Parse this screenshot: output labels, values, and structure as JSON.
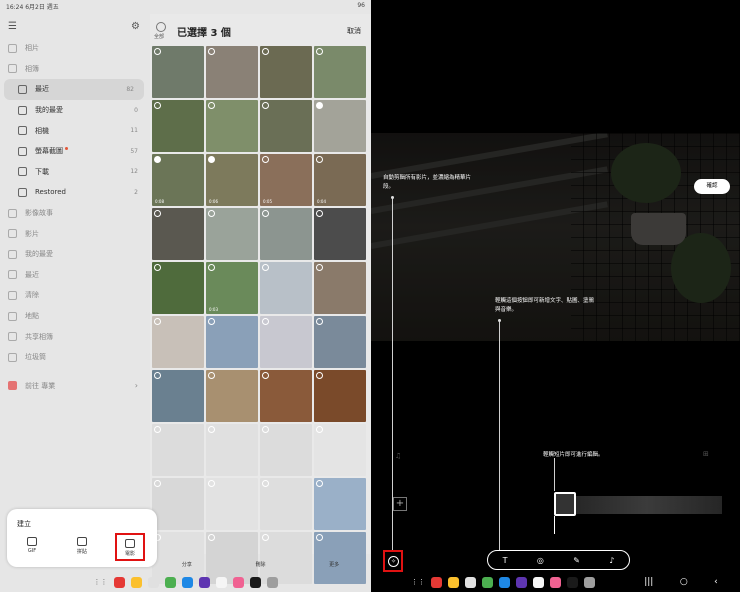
{
  "status": {
    "time": "16:24",
    "date": "6月2日 週五",
    "battery": "96"
  },
  "sidebar": {
    "items": [
      {
        "label": "相片",
        "count": "",
        "type": "top"
      },
      {
        "label": "相簿",
        "count": "",
        "type": "top"
      },
      {
        "label": "最近",
        "count": "82",
        "type": "sub",
        "selected": true
      },
      {
        "label": "我的最愛",
        "count": "0",
        "type": "sub"
      },
      {
        "label": "相機",
        "count": "11",
        "type": "sub"
      },
      {
        "label": "螢幕截圖",
        "count": "57",
        "type": "sub",
        "dot": true
      },
      {
        "label": "下載",
        "count": "12",
        "type": "sub"
      },
      {
        "label": "Restored",
        "count": "2",
        "type": "sub"
      },
      {
        "label": "影像故事",
        "count": "",
        "type": "top"
      },
      {
        "label": "影片",
        "count": "",
        "type": "top"
      },
      {
        "label": "我的最愛",
        "count": "",
        "type": "top"
      },
      {
        "label": "最近",
        "count": "",
        "type": "top"
      },
      {
        "label": "清除",
        "count": "",
        "type": "top"
      },
      {
        "label": "地點",
        "count": "",
        "type": "top"
      },
      {
        "label": "共享相簿",
        "count": "",
        "type": "top"
      },
      {
        "label": "垃圾筒",
        "count": "",
        "type": "top"
      },
      {
        "label": "前往 專業",
        "count": "",
        "type": "promo"
      }
    ]
  },
  "gallery": {
    "select_all": "全部",
    "title": "已選擇 3 個",
    "cancel": "取消",
    "thumbs": [
      {
        "color": "#6f7a6a",
        "check": false
      },
      {
        "color": "#8a8176",
        "check": false
      },
      {
        "color": "#6b6a52",
        "check": false
      },
      {
        "color": "#7a8a6a",
        "check": false
      },
      {
        "color": "#5e6e4a",
        "check": false
      },
      {
        "color": "#7f8f6a",
        "check": false
      },
      {
        "color": "#6a6f56",
        "check": false
      },
      {
        "color": "#a3a399",
        "check": true
      },
      {
        "color": "#6b7557",
        "check": true,
        "dur": "0:08"
      },
      {
        "color": "#7d7a5c",
        "check": true,
        "dur": "0:06"
      },
      {
        "color": "#8a6f5a",
        "check": false,
        "dur": "0:05"
      },
      {
        "color": "#7a6a54",
        "check": false,
        "dur": "0:04"
      },
      {
        "color": "#5a5850",
        "check": false
      },
      {
        "color": "#9aa39a",
        "check": false
      },
      {
        "color": "#8c9590",
        "check": false
      },
      {
        "color": "#4c4c4c",
        "check": false
      },
      {
        "color": "#4f6b3c",
        "check": false
      },
      {
        "color": "#6a8a5a",
        "check": false,
        "dur": "0:03"
      },
      {
        "color": "#b8c0c8",
        "check": false
      },
      {
        "color": "#8a7a6a",
        "check": false
      },
      {
        "color": "#c8c0b8",
        "check": false
      },
      {
        "color": "#8aa0b8",
        "check": false
      },
      {
        "color": "#c8c8d0",
        "check": false
      },
      {
        "color": "#7a8a9a",
        "check": false
      },
      {
        "color": "#6a8090",
        "check": false
      },
      {
        "color": "#a89070",
        "check": false
      },
      {
        "color": "#8a5a3a",
        "check": false
      },
      {
        "color": "#7a4a2a",
        "check": false
      },
      {
        "color": "#dcdcdc",
        "check": false
      },
      {
        "color": "#e0e0e0",
        "check": false
      },
      {
        "color": "#dcdcdc",
        "check": false
      },
      {
        "color": "#e4e4e4",
        "check": false
      },
      {
        "color": "#d8d8d8",
        "check": false
      },
      {
        "color": "#e2e2e2",
        "check": false
      },
      {
        "color": "#dedede",
        "check": false
      },
      {
        "color": "#9ab0c8",
        "check": false
      },
      {
        "color": "#e0e0e0",
        "check": false
      },
      {
        "color": "#d4d4d4",
        "check": false
      },
      {
        "color": "#dcdcdc",
        "check": false
      },
      {
        "color": "#8aa0b8",
        "check": false
      }
    ]
  },
  "bottom_actions": [
    "分享",
    "刪除",
    "更多"
  ],
  "create": {
    "title": "建立",
    "buttons": [
      {
        "label": "GIF"
      },
      {
        "label": "拼貼"
      },
      {
        "label": "電影"
      }
    ]
  },
  "editor": {
    "tip1": "自動剪輯所有影片，並濃縮為精華片段。",
    "tip2": "輕觸這個按鈕即可新增文字、貼圖、塗鴉與音樂。",
    "tip3": "輕觸短片即可進行編輯。",
    "confirm": "確認",
    "tools": [
      "T",
      "◎",
      "✎",
      "♪"
    ]
  },
  "dock_colors": [
    "#e53935",
    "#fbc02d",
    "#e0e0e0",
    "#4caf50",
    "#1e88e5",
    "#5e35b1",
    "#f5f5f5",
    "#f06292",
    "#1a1a1a",
    "#9e9e9e"
  ]
}
